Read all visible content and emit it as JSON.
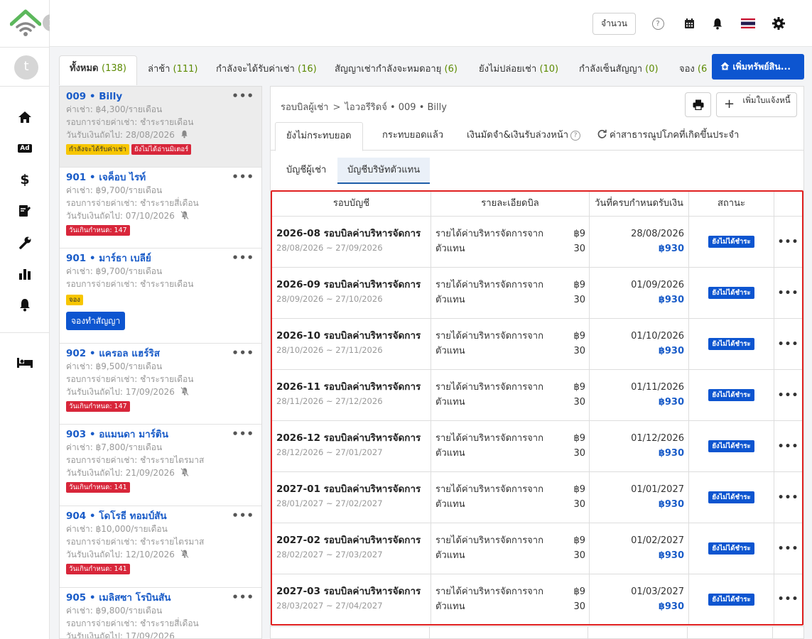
{
  "rail": {
    "avatar_letter": "t",
    "nav": [
      "home-icon",
      "ad-icon",
      "dollar-icon",
      "contract-icon",
      "wrench-icon",
      "bar-chart-icon",
      "bell-icon",
      "bed-icon"
    ],
    "ad_label": "Ad",
    "dollar_label": "$"
  },
  "topbar": {
    "qty_label": "จำนวน",
    "help_glyph": "?"
  },
  "tabs": [
    {
      "label": "ทั้งหมด",
      "count": "(138)"
    },
    {
      "label": "ล่าช้า",
      "count": "(111)"
    },
    {
      "label": "กำลังจะได้รับค่าเช่า",
      "count": "(16)"
    },
    {
      "label": "สัญญาเช่ากำลังจะหมดอายุ",
      "count": "(6)"
    },
    {
      "label": "ยังไม่ปล่อยเช่า",
      "count": "(10)"
    },
    {
      "label": "กำลังเซ็นสัญญา",
      "count": "(0)"
    },
    {
      "label": "จอง",
      "count": "(6"
    }
  ],
  "add_asset_label": "เพิ่มทรัพย์สิน...",
  "tenants": [
    {
      "unit": "009",
      "name": "Billy",
      "rent": "ค่าเช่า: ฿4,300/รายเดือน",
      "cycle": "รอบการจ่ายค่าเช่า: ชำระรายเดือน",
      "next": "วันรับเงินถัดไป:  28/08/2026",
      "badges": [
        "กำลังจะได้รับค่าเช่า",
        "ยังไม่ได้อ่านมิเตอร์"
      ]
    },
    {
      "unit": "901",
      "name": "เจค็อบ ไรท์",
      "rent": "ค่าเช่า: ฿9,700/รายเดือน",
      "cycle": "รอบการจ่ายค่าเช่า: ชำระรายสี่เดือน",
      "next": "วันรับเงินถัดไป:  07/10/2026",
      "badges": [
        "วันเกินกำหนด: 147"
      ]
    },
    {
      "unit": "901",
      "name": "มาร์ธา เบลีย์",
      "rent": "ค่าเช่า: ฿9,700/รายเดือน",
      "cycle": "รอบการจ่ายค่าเช่า: ชำระรายเดือน",
      "badges": [
        "จอง"
      ],
      "button": "จองทำสัญญา"
    },
    {
      "unit": "902",
      "name": "แครอล แฮร์ริส",
      "rent": "ค่าเช่า: ฿9,500/รายเดือน",
      "cycle": "รอบการจ่ายค่าเช่า: ชำระรายเดือน",
      "next": "วันรับเงินถัดไป:  17/09/2026",
      "badges": [
        "วันเกินกำหนด: 147"
      ]
    },
    {
      "unit": "903",
      "name": "อแมนดา มาร์ติน",
      "rent": "ค่าเช่า: ฿7,800/รายเดือน",
      "cycle": "รอบการจ่ายค่าเช่า: ชำระรายไตรมาส",
      "next": "วันรับเงินถัดไป:  21/09/2026",
      "badges": [
        "วันเกินกำหนด: 141"
      ]
    },
    {
      "unit": "904",
      "name": "โดโรธี ทอมป์สัน",
      "rent": "ค่าเช่า: ฿10,000/รายเดือน",
      "cycle": "รอบการจ่ายค่าเช่า: ชำระรายไตรมาส",
      "next": "วันรับเงินถัดไป:  12/10/2026",
      "badges": [
        "วันเกินกำหนด: 141"
      ]
    },
    {
      "unit": "905",
      "name": "เมลิสซา โรบินสัน",
      "rent": "ค่าเช่า: ฿9,800/รายเดือน",
      "cycle": "รอบการจ่ายค่าเช่า: ชำระรายสี่เดือน",
      "next": "วันรับเงินถัดไป:  17/09/2026",
      "badges": []
    }
  ],
  "breadcrumb": {
    "root": "รอบบิลผู้เช่า",
    "sep": ">",
    "current": "ไอวอรีริดจ์ • 009 • Billy"
  },
  "notice_button": "เพิ่มใบแจ้งหนี้",
  "subtabs": [
    "ยังไม่กระทบยอด",
    "กระทบยอดแล้ว",
    "เงินมัดจำ&เงินรับล่วงหน้า",
    "ค่าสาธารณูปโภคที่เกิดขึ้นประจำ"
  ],
  "pills": [
    "บัญชีผู้เช่า",
    "บัญชีบริษัทตัวแทน"
  ],
  "table": {
    "headers": [
      "รอบบัญชี",
      "รายละเอียดบิล",
      "วันที่ครบกำหนดรับเงิน",
      "สถานะ"
    ],
    "rows": [
      {
        "cycle": "2026-08 รอบบิลค่าบริหารจัดการ",
        "range": "28/08/2026 ~ 27/09/2026",
        "detail": "รายได้ค่าบริหารจัดการจากตัวแทน",
        "amount": "฿930",
        "due": "28/08/2026",
        "due_amount": "฿930",
        "status": "ยังไม่ได้ชำระ"
      },
      {
        "cycle": "2026-09 รอบบิลค่าบริหารจัดการ",
        "range": "28/09/2026 ~ 27/10/2026",
        "detail": "รายได้ค่าบริหารจัดการจากตัวแทน",
        "amount": "฿930",
        "due": "01/09/2026",
        "due_amount": "฿930",
        "status": "ยังไม่ได้ชำระ"
      },
      {
        "cycle": "2026-10 รอบบิลค่าบริหารจัดการ",
        "range": "28/10/2026 ~ 27/11/2026",
        "detail": "รายได้ค่าบริหารจัดการจากตัวแทน",
        "amount": "฿930",
        "due": "01/10/2026",
        "due_amount": "฿930",
        "status": "ยังไม่ได้ชำระ"
      },
      {
        "cycle": "2026-11 รอบบิลค่าบริหารจัดการ",
        "range": "28/11/2026 ~ 27/12/2026",
        "detail": "รายได้ค่าบริหารจัดการจากตัวแทน",
        "amount": "฿930",
        "due": "01/11/2026",
        "due_amount": "฿930",
        "status": "ยังไม่ได้ชำระ"
      },
      {
        "cycle": "2026-12 รอบบิลค่าบริหารจัดการ",
        "range": "28/12/2026 ~ 27/01/2027",
        "detail": "รายได้ค่าบริหารจัดการจากตัวแทน",
        "amount": "฿930",
        "due": "01/12/2026",
        "due_amount": "฿930",
        "status": "ยังไม่ได้ชำระ"
      },
      {
        "cycle": "2027-01 รอบบิลค่าบริหารจัดการ",
        "range": "28/01/2027 ~ 27/02/2027",
        "detail": "รายได้ค่าบริหารจัดการจากตัวแทน",
        "amount": "฿930",
        "due": "01/01/2027",
        "due_amount": "฿930",
        "status": "ยังไม่ได้ชำระ"
      },
      {
        "cycle": "2027-02 รอบบิลค่าบริหารจัดการ",
        "range": "28/02/2027 ~ 27/03/2027",
        "detail": "รายได้ค่าบริหารจัดการจากตัวแทน",
        "amount": "฿930",
        "due": "01/02/2027",
        "due_amount": "฿930",
        "status": "ยังไม่ได้ชำระ"
      },
      {
        "cycle": "2027-03 รอบบิลค่าบริหารจัดการ",
        "range": "28/03/2027 ~ 27/04/2027",
        "detail": "รายได้ค่าบริหารจัดการจากตัวแทน",
        "amount": "฿930",
        "due": "01/03/2027",
        "due_amount": "฿930",
        "status": "ยังไม่ได้ชำระ"
      }
    ]
  },
  "colors": {
    "accent": "#0d55d0",
    "danger": "#d8263a",
    "warning": "#f7c600",
    "count_green": "#5b8a00",
    "highlight_border": "#e02020"
  }
}
